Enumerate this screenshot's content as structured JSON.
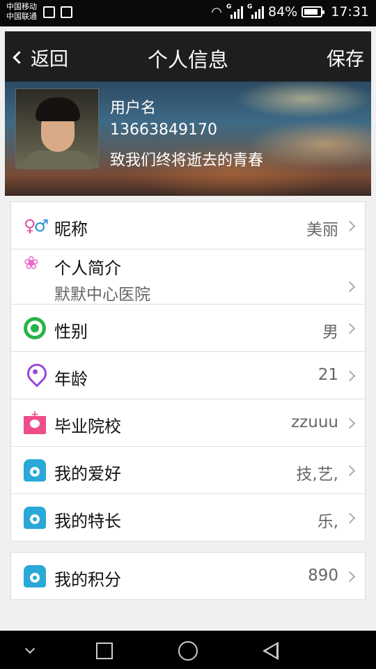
{
  "status_bar": {
    "carrier1": "中国移动",
    "carrier2": "中国联通",
    "signal1_label": "G",
    "signal2_label": "G",
    "battery": "84%",
    "time": "17:31"
  },
  "header": {
    "back_label": "返回",
    "title": "个人信息",
    "save_label": "保存"
  },
  "profile": {
    "username": "用户名",
    "phone": "13663849170",
    "motto": "致我们终将逝去的青春"
  },
  "rows": [
    {
      "icon": "gender-icon",
      "label": "昵称",
      "value": "美丽"
    },
    {
      "icon": "lotus-icon",
      "label": "个人简介",
      "value": "默默中心医院"
    },
    {
      "icon": "target-icon",
      "label": "性别",
      "value": "男"
    },
    {
      "icon": "location-pin-icon",
      "label": "年龄",
      "value": "21"
    },
    {
      "icon": "nurse-icon",
      "label": "毕业院校",
      "value": "zzuuu"
    },
    {
      "icon": "phone-icon",
      "label": "我的爱好",
      "value": "技,艺,"
    },
    {
      "icon": "phone-icon",
      "label": "我的特长",
      "value": "乐,"
    }
  ],
  "points": {
    "icon": "phone-icon",
    "label": "我的积分",
    "value": "890"
  },
  "colors": {
    "title_bar": "#1e1e1e",
    "background": "#f0f0f0",
    "icon_green": "#29b24a",
    "icon_blue": "#2aa8d8",
    "icon_pink": "#ef4d8a"
  }
}
